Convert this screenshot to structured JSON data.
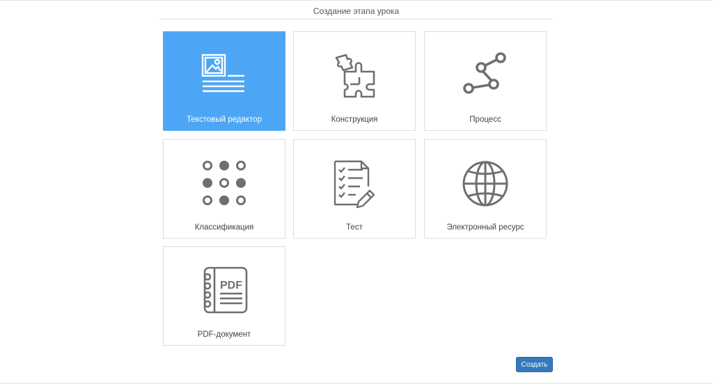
{
  "dialog": {
    "title": "Создание этапа урока"
  },
  "tiles": [
    {
      "label": "Текстовый редактор",
      "icon": "text-editor-icon",
      "selected": true
    },
    {
      "label": "Конструкция",
      "icon": "puzzle-icon",
      "selected": false
    },
    {
      "label": "Процесс",
      "icon": "process-icon",
      "selected": false
    },
    {
      "label": "Классификация",
      "icon": "dots-grid-icon",
      "selected": false
    },
    {
      "label": "Тест",
      "icon": "test-checklist-icon",
      "selected": false
    },
    {
      "label": "Электронный ресурс",
      "icon": "globe-icon",
      "selected": false
    },
    {
      "label": "PDF-документ",
      "icon": "pdf-notebook-icon",
      "selected": false
    }
  ],
  "icon_text": {
    "pdf": "PDF"
  },
  "footer": {
    "create_label": "Создать"
  },
  "colors": {
    "selected_tile": "#4da6f5",
    "icon_gray": "#6f6f6f",
    "button": "#3479bd"
  }
}
